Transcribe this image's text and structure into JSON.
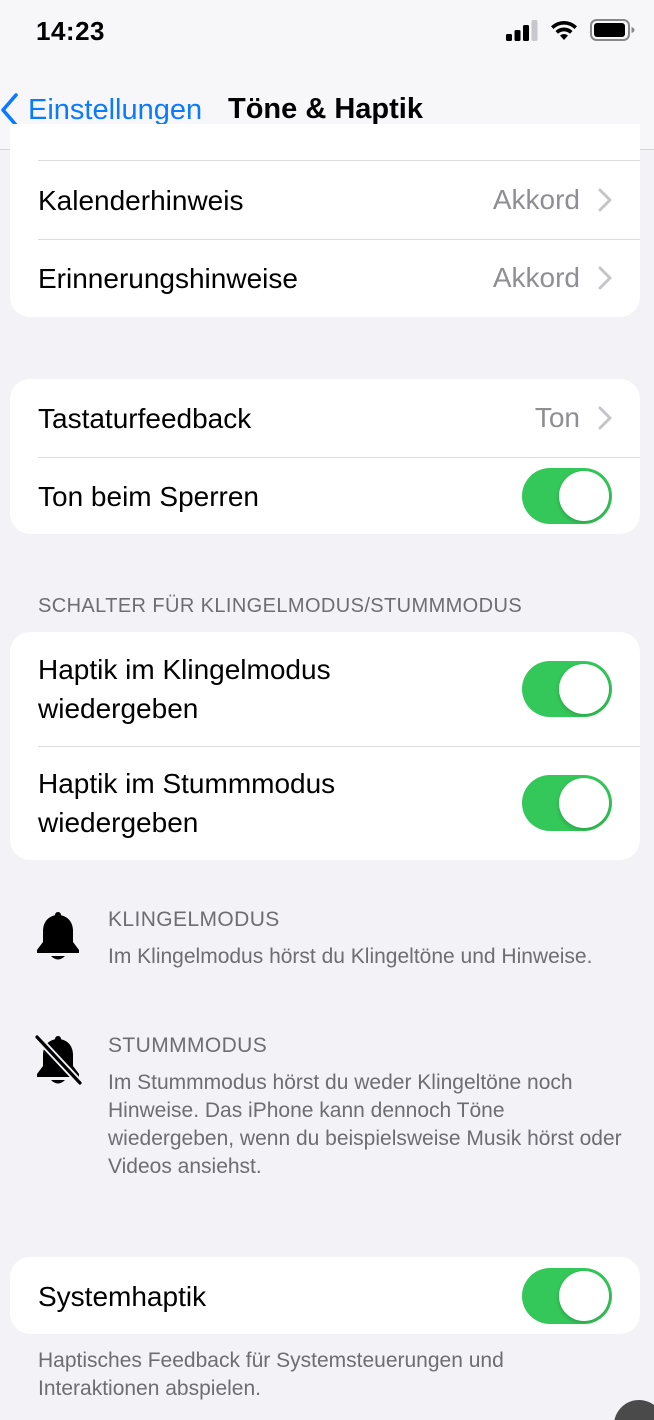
{
  "status_bar": {
    "time": "14:23"
  },
  "nav": {
    "back_label": "Einstellungen",
    "title": "Töne & Haptik"
  },
  "group1": {
    "rows": [
      {
        "label": "Kalenderhinweis",
        "value": "Akkord"
      },
      {
        "label": "Erinnerungshinweise",
        "value": "Akkord"
      }
    ]
  },
  "group2": {
    "rows": [
      {
        "label": "Tastaturfeedback",
        "value": "Ton"
      },
      {
        "label": "Ton beim Sperren",
        "toggle": true
      }
    ]
  },
  "ring_silent": {
    "header": "SCHALTER FÜR KLINGELMODUS/STUMMMODUS",
    "rows": [
      {
        "label_line1": "Haptik im Klingelmodus",
        "label_line2": "wiedergeben",
        "toggle": true
      },
      {
        "label_line1": "Haptik im Stummmodus",
        "label_line2": "wiedergeben",
        "toggle": true
      }
    ]
  },
  "info": {
    "ring": {
      "icon": "bell-icon",
      "title": "KLINGELMODUS",
      "text": "Im Klingelmodus hörst du Klingeltöne und Hinweise."
    },
    "silent": {
      "icon": "bell-slash-icon",
      "title": "STUMMMODUS",
      "text": "Im Stummmodus hörst du weder Klingeltöne noch Hinweise. Das iPhone kann dennoch Töne wiedergeben, wenn du beispielsweise Musik hörst oder Videos ansiehst."
    }
  },
  "system_haptics": {
    "label": "Systemhaptik",
    "toggle": true,
    "footer": "Haptisches Feedback für Systemsteuerungen und Interaktionen abspielen."
  },
  "colors": {
    "accent": "#0a7aff",
    "toggle_on": "#34c759",
    "background": "#f2f2f7",
    "secondary_text": "#8e8e93"
  }
}
